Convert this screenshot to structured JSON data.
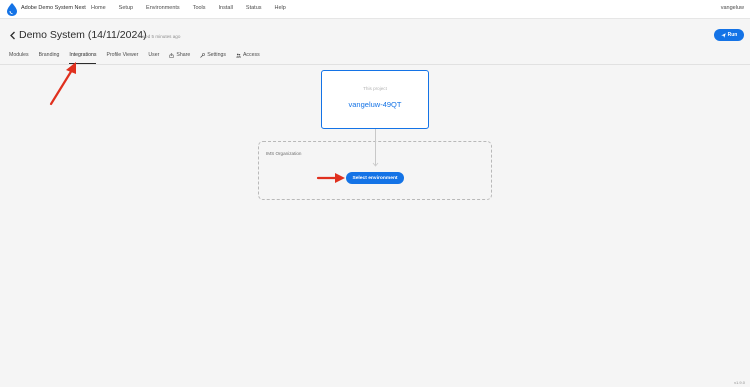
{
  "app": {
    "title": "Adobe Demo System Next",
    "brand_color": "#1473e6"
  },
  "topnav": {
    "items": [
      "Home",
      "Setup",
      "Environments",
      "Tools",
      "Install",
      "Status",
      "Help"
    ],
    "user": "vangeluw"
  },
  "header": {
    "title": "Demo System (14/11/2024)",
    "saved": "saved 5 minutes ago",
    "run_label": "Run",
    "run_icon": "send-icon"
  },
  "tabs": [
    {
      "label": "Modules",
      "icon": null
    },
    {
      "label": "Branding",
      "icon": null
    },
    {
      "label": "Integrations",
      "icon": null,
      "active": true
    },
    {
      "label": "Profile Viewer",
      "icon": null
    },
    {
      "label": "User",
      "icon": null
    },
    {
      "label": "Share",
      "icon": "share-icon"
    },
    {
      "label": "Settings",
      "icon": "wrench-icon"
    },
    {
      "label": "Access",
      "icon": "users-icon"
    }
  ],
  "project": {
    "label": "This project",
    "name": "vangeluw-49QT"
  },
  "ims": {
    "label": "IMS Organization",
    "button_label": "Select environment"
  },
  "footer": {
    "version": "v1.9.0"
  },
  "annotations": {
    "arrow_color": "#e0301e"
  }
}
